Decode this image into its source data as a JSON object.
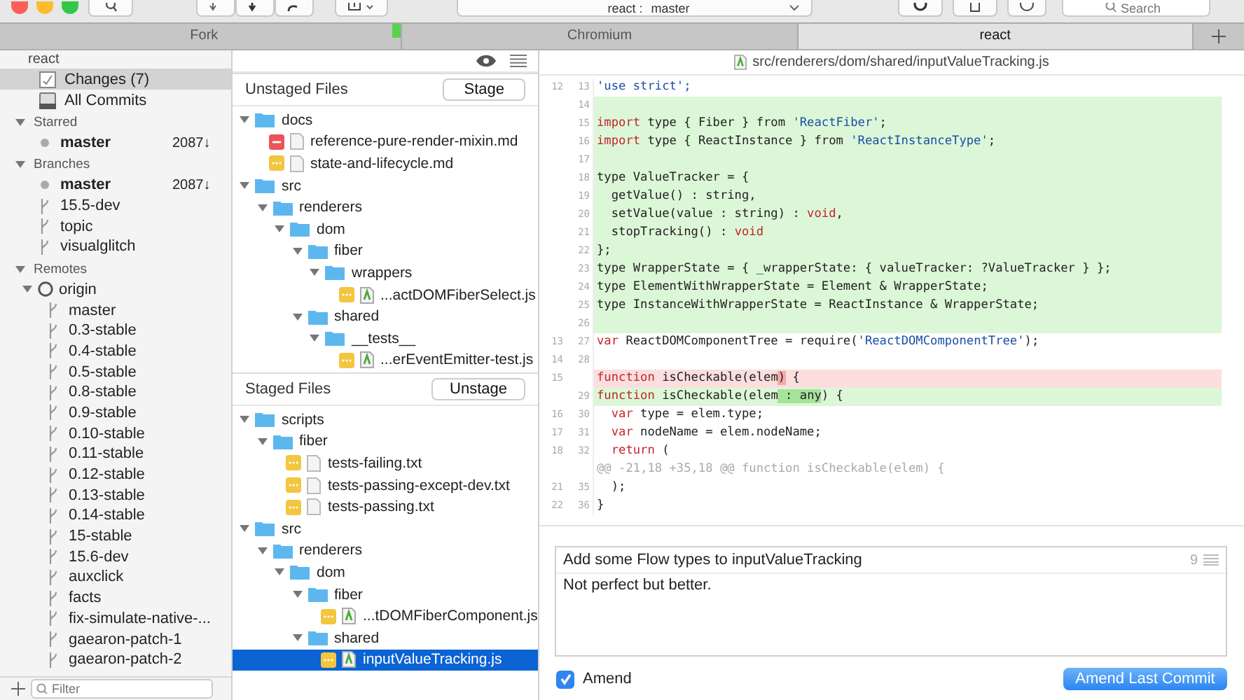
{
  "toolbar": {
    "repo": "react :",
    "branch": "master",
    "search_placeholder": "Search"
  },
  "tabs": [
    {
      "label": "Fork",
      "selected": false,
      "marker": true
    },
    {
      "label": "Chromium",
      "selected": false,
      "marker": false
    },
    {
      "label": "react",
      "selected": true,
      "marker": false
    }
  ],
  "sidebar": {
    "repo": "react",
    "nav": [
      {
        "label": "Changes (7)",
        "kind": "changes",
        "selected": true
      },
      {
        "label": "All Commits",
        "kind": "commits",
        "selected": false
      }
    ],
    "sections": [
      {
        "title": "Starred",
        "expanded": true,
        "items": [
          {
            "label": "master",
            "kind": "current",
            "count": "2087↓"
          }
        ]
      },
      {
        "title": "Branches",
        "expanded": true,
        "items": [
          {
            "label": "master",
            "kind": "current",
            "count": "2087↓"
          },
          {
            "label": "15.5-dev",
            "kind": "branch"
          },
          {
            "label": "topic",
            "kind": "branch"
          },
          {
            "label": "visualglitch",
            "kind": "branch"
          }
        ]
      },
      {
        "title": "Remotes",
        "expanded": true,
        "items": [
          {
            "label": "origin",
            "kind": "remote",
            "expanded": true,
            "children": [
              {
                "label": "master",
                "kind": "branch"
              },
              {
                "label": "0.3-stable",
                "kind": "branch"
              },
              {
                "label": "0.4-stable",
                "kind": "branch"
              },
              {
                "label": "0.5-stable",
                "kind": "branch"
              },
              {
                "label": "0.8-stable",
                "kind": "branch"
              },
              {
                "label": "0.9-stable",
                "kind": "branch"
              },
              {
                "label": "0.10-stable",
                "kind": "branch"
              },
              {
                "label": "0.11-stable",
                "kind": "branch"
              },
              {
                "label": "0.12-stable",
                "kind": "branch"
              },
              {
                "label": "0.13-stable",
                "kind": "branch"
              },
              {
                "label": "0.14-stable",
                "kind": "branch"
              },
              {
                "label": "15-stable",
                "kind": "branch"
              },
              {
                "label": "15.6-dev",
                "kind": "branch"
              },
              {
                "label": "auxclick",
                "kind": "branch"
              },
              {
                "label": "facts",
                "kind": "branch"
              },
              {
                "label": "fix-simulate-native-...",
                "kind": "branch"
              },
              {
                "label": "gaearon-patch-1",
                "kind": "branch"
              },
              {
                "label": "gaearon-patch-2",
                "kind": "branch"
              }
            ]
          }
        ]
      }
    ],
    "filter_placeholder": "Filter"
  },
  "unstaged": {
    "title": "Unstaged Files",
    "button": "Stage",
    "tree": [
      {
        "label": "docs",
        "kind": "folder",
        "expanded": true,
        "children": [
          {
            "label": "reference-pure-render-mixin.md",
            "kind": "doc",
            "deleted": true,
            "selected": false
          },
          {
            "label": "state-and-lifecycle.md",
            "kind": "doc",
            "deleted": false,
            "selected": false
          }
        ]
      },
      {
        "label": "src",
        "kind": "folder",
        "expanded": true,
        "children": [
          {
            "label": "renderers",
            "kind": "folder",
            "expanded": true,
            "children": [
              {
                "label": "dom",
                "kind": "folder",
                "expanded": true,
                "children": [
                  {
                    "label": "fiber",
                    "kind": "folder",
                    "expanded": true,
                    "children": [
                      {
                        "label": "wrappers",
                        "kind": "folder",
                        "expanded": true,
                        "children": [
                          {
                            "label": "...actDOMFiberSelect.js",
                            "kind": "js",
                            "deleted": false,
                            "selected": false
                          }
                        ]
                      }
                    ]
                  },
                  {
                    "label": "shared",
                    "kind": "folder",
                    "expanded": true,
                    "children": [
                      {
                        "label": "__tests__",
                        "kind": "folder",
                        "expanded": true,
                        "children": [
                          {
                            "label": "...erEventEmitter-test.js",
                            "kind": "js",
                            "deleted": false,
                            "selected": false
                          }
                        ]
                      }
                    ]
                  }
                ]
              }
            ]
          }
        ]
      }
    ]
  },
  "staged": {
    "title": "Staged Files",
    "button": "Unstage",
    "tree": [
      {
        "label": "scripts",
        "kind": "folder",
        "expanded": true,
        "children": [
          {
            "label": "fiber",
            "kind": "folder",
            "expanded": true,
            "children": [
              {
                "label": "tests-failing.txt",
                "kind": "doc",
                "deleted": false,
                "selected": false
              },
              {
                "label": "tests-passing-except-dev.txt",
                "kind": "doc",
                "deleted": false,
                "selected": false
              },
              {
                "label": "tests-passing.txt",
                "kind": "doc",
                "deleted": false,
                "selected": false
              }
            ]
          }
        ]
      },
      {
        "label": "src",
        "kind": "folder",
        "expanded": true,
        "children": [
          {
            "label": "renderers",
            "kind": "folder",
            "expanded": true,
            "children": [
              {
                "label": "dom",
                "kind": "folder",
                "expanded": true,
                "children": [
                  {
                    "label": "fiber",
                    "kind": "folder",
                    "expanded": true,
                    "children": [
                      {
                        "label": "...tDOMFiberComponent.js",
                        "kind": "js",
                        "deleted": false,
                        "selected": false
                      }
                    ]
                  },
                  {
                    "label": "shared",
                    "kind": "folder",
                    "expanded": true,
                    "children": [
                      {
                        "label": "inputValueTracking.js",
                        "kind": "js",
                        "deleted": false,
                        "selected": true
                      }
                    ]
                  }
                ]
              }
            ]
          }
        ]
      }
    ]
  },
  "diff": {
    "path": "src/renderers/dom/shared/inputValueTracking.js",
    "lines": [
      {
        "old": "12",
        "new": "13",
        "kind": "context",
        "segments": [
          {
            "text": "'use strict';",
            "kind": "string"
          }
        ]
      },
      {
        "new": "14",
        "kind": "added"
      },
      {
        "new": "15",
        "kind": "added",
        "segments": [
          {
            "text": "import",
            "kind": "keyword"
          },
          {
            "text": " type { Fiber } from ",
            "kind": "plain"
          },
          {
            "text": "'ReactFiber'",
            "kind": "string"
          },
          {
            "text": ";",
            "kind": "plain"
          }
        ]
      },
      {
        "new": "16",
        "kind": "added",
        "segments": [
          {
            "text": "import",
            "kind": "keyword"
          },
          {
            "text": " type { ReactInstance } from ",
            "kind": "plain"
          },
          {
            "text": "'ReactInstanceType'",
            "kind": "string"
          },
          {
            "text": ";",
            "kind": "plain"
          }
        ]
      },
      {
        "new": "17",
        "kind": "added"
      },
      {
        "new": "18",
        "kind": "added",
        "segments": [
          {
            "text": "type ValueTracker = {",
            "kind": "plain"
          }
        ]
      },
      {
        "new": "19",
        "kind": "added",
        "segments": [
          {
            "text": "  getValue() : string,",
            "kind": "plain"
          }
        ]
      },
      {
        "new": "20",
        "kind": "added",
        "segments": [
          {
            "text": "  setValue(value : string) : ",
            "kind": "plain"
          },
          {
            "text": "void",
            "kind": "keyword"
          },
          {
            "text": ",",
            "kind": "plain"
          }
        ]
      },
      {
        "new": "21",
        "kind": "added",
        "segments": [
          {
            "text": "  stopTracking() : ",
            "kind": "plain"
          },
          {
            "text": "void",
            "kind": "keyword"
          }
        ]
      },
      {
        "new": "22",
        "kind": "added",
        "segments": [
          {
            "text": "};",
            "kind": "plain"
          }
        ]
      },
      {
        "new": "23",
        "kind": "added",
        "segments": [
          {
            "text": "type WrapperState = { _wrapperState: { valueTracker: ?ValueTracker } };",
            "kind": "plain"
          }
        ]
      },
      {
        "new": "24",
        "kind": "added",
        "segments": [
          {
            "text": "type ElementWithWrapperState = Element & WrapperState;",
            "kind": "plain"
          }
        ]
      },
      {
        "new": "25",
        "kind": "added",
        "segments": [
          {
            "text": "type InstanceWithWrapperState = ReactInstance & WrapperState;",
            "kind": "plain"
          }
        ]
      },
      {
        "new": "26",
        "kind": "added"
      },
      {
        "old": "13",
        "new": "27",
        "kind": "context",
        "segments": [
          {
            "text": "var",
            "kind": "keyword"
          },
          {
            "text": " ReactDOMComponentTree = require(",
            "kind": "plain"
          },
          {
            "text": "'ReactDOMComponentTree'",
            "kind": "string"
          },
          {
            "text": ");",
            "kind": "plain"
          }
        ]
      },
      {
        "old": "14",
        "new": "28",
        "kind": "context"
      },
      {
        "old": "15",
        "kind": "removed",
        "segments": [
          {
            "text": "function",
            "kind": "keyword"
          },
          {
            "text": " isCheckable(elem",
            "kind": "plain"
          },
          {
            "text": ")",
            "kind": "changed"
          },
          {
            "text": " {",
            "kind": "plain"
          }
        ]
      },
      {
        "new": "29",
        "kind": "added",
        "segments": [
          {
            "text": "function",
            "kind": "keyword"
          },
          {
            "text": " isCheckable(elem",
            "kind": "plain"
          },
          {
            "text": " : any",
            "kind": "changed"
          },
          {
            "text": ") {",
            "kind": "plain"
          }
        ]
      },
      {
        "old": "16",
        "new": "30",
        "kind": "context",
        "segments": [
          {
            "text": "  var",
            "kind": "keyword"
          },
          {
            "text": " type = elem.type;",
            "kind": "plain"
          }
        ]
      },
      {
        "old": "17",
        "new": "31",
        "kind": "context",
        "segments": [
          {
            "text": "  var",
            "kind": "keyword"
          },
          {
            "text": " nodeName = elem.nodeName;",
            "kind": "plain"
          }
        ]
      },
      {
        "old": "18",
        "new": "32",
        "kind": "context",
        "segments": [
          {
            "text": "  return",
            "kind": "keyword"
          },
          {
            "text": " (",
            "kind": "plain"
          }
        ]
      },
      {
        "kind": "hunk",
        "segments": [
          {
            "text": "@@ -21,18 +35,18 @@ function isCheckable(elem) {",
            "kind": "plain"
          }
        ]
      },
      {
        "old": "21",
        "new": "35",
        "kind": "context",
        "segments": [
          {
            "text": "  );",
            "kind": "plain"
          }
        ]
      },
      {
        "old": "22",
        "new": "36",
        "kind": "context",
        "segments": [
          {
            "text": "}",
            "kind": "plain"
          }
        ]
      }
    ]
  },
  "commit": {
    "subject": "Add some Flow types to inputValueTracking",
    "body": "Not perfect but better.",
    "count": "9",
    "amend": {
      "label": "Amend",
      "checked": true
    },
    "button": "Amend Last Commit"
  }
}
